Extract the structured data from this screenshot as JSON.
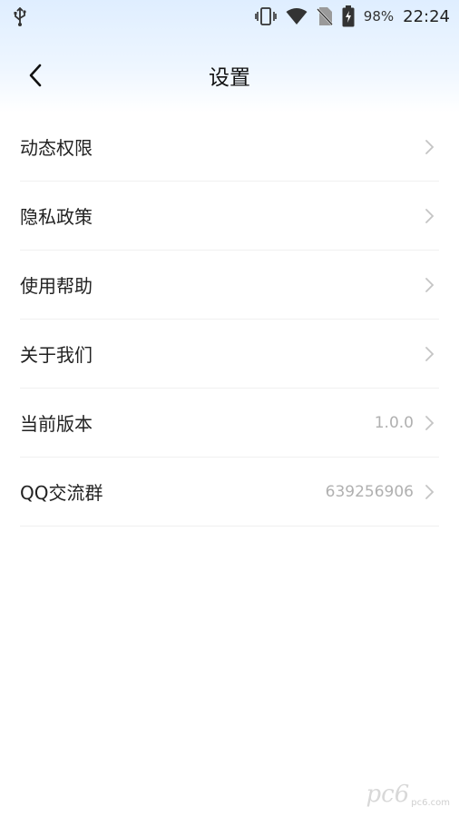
{
  "status_bar": {
    "battery_percent": "98%",
    "time": "22:24"
  },
  "header": {
    "title": "设置"
  },
  "settings": {
    "items": [
      {
        "label": "动态权限",
        "value": ""
      },
      {
        "label": "隐私政策",
        "value": ""
      },
      {
        "label": "使用帮助",
        "value": ""
      },
      {
        "label": "关于我们",
        "value": ""
      },
      {
        "label": "当前版本",
        "value": "1.0.0"
      },
      {
        "label": "QQ交流群",
        "value": "639256906"
      }
    ]
  },
  "icons": {
    "usb": "usb-icon",
    "vibrate": "vibrate-icon",
    "wifi": "wifi-icon",
    "no_sim": "no-sim-icon",
    "battery": "battery-charging-icon",
    "back": "chevron-left-icon",
    "chevron": "chevron-right-icon"
  },
  "colors": {
    "header_gradient_top": "#dfeeff",
    "value_text": "#b0b0b0",
    "chevron": "#c4c4c4"
  },
  "watermark": {
    "text": "pc6",
    "sub": "pc6.com"
  }
}
